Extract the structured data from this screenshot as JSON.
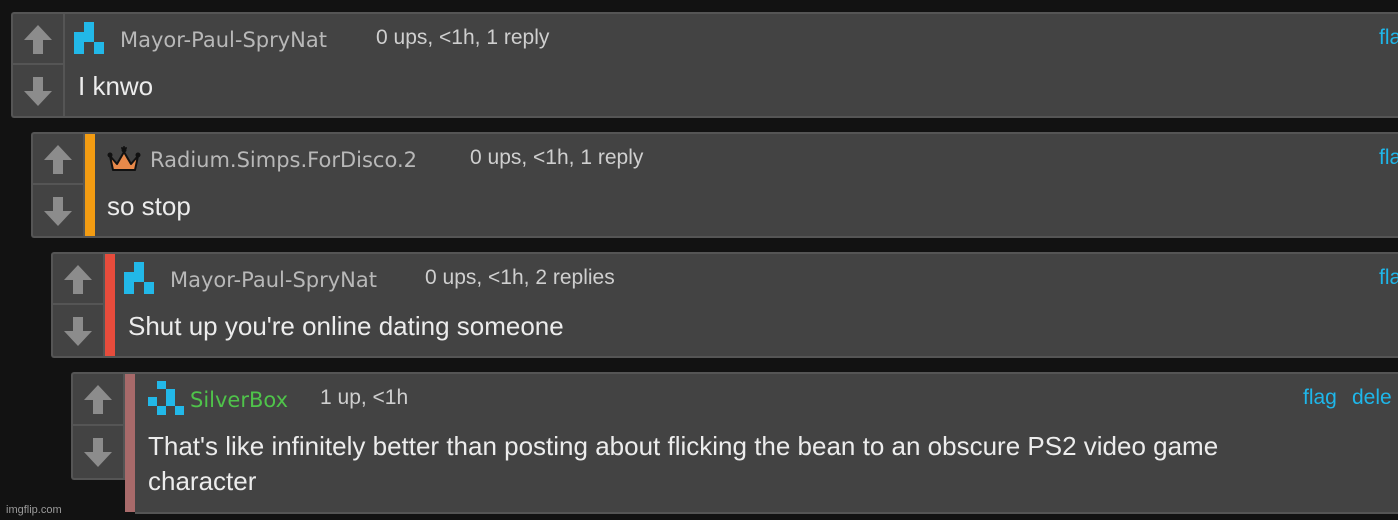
{
  "comments": [
    {
      "username": "Mayor-Paul-SpryNat",
      "username_color": "#b8b8b8",
      "avatar": "pixel-avatar-icon",
      "meta": "0 ups, <1h, 1 reply",
      "text_lines": [
        "I knwo"
      ],
      "actions": [
        "fla"
      ]
    },
    {
      "username": "Radium.Simps.ForDisco.2",
      "username_color": "#b8b8b8",
      "avatar": "crown-icon",
      "bar_color": "#f39c12",
      "meta": "0 ups, <1h, 1 reply",
      "text_lines": [
        "so stop"
      ],
      "actions": [
        "fla"
      ]
    },
    {
      "username": "Mayor-Paul-SpryNat",
      "username_color": "#b8b8b8",
      "avatar": "pixel-avatar-icon",
      "bar_color": "#e74c3c",
      "meta": "0 ups, <1h, 2 replies",
      "text_lines": [
        "Shut up you're online dating someone"
      ],
      "actions": [
        "fla"
      ]
    },
    {
      "username": "SilverBox",
      "username_color": "#4fc34a",
      "avatar": "pixel-avatar-icon",
      "bar_color": "#a86a6a",
      "meta": "1 up, <1h",
      "text_lines": [
        "That's like infinitely better than posting about flicking the bean to an obscure PS2 video game",
        "character"
      ],
      "actions": [
        "flag",
        "dele"
      ]
    }
  ],
  "watermark": "imgflip.com"
}
